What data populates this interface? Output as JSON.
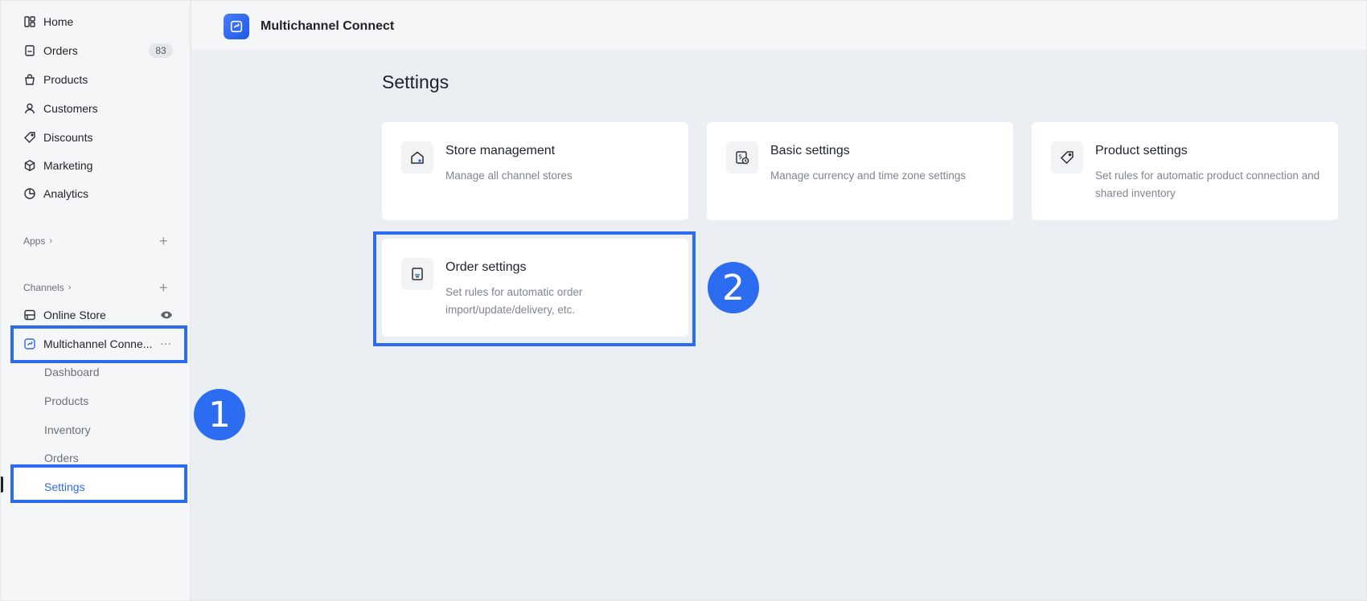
{
  "app": {
    "title": "Multichannel Connect",
    "logo_icon": "app-logo-icon",
    "accent": "#2b6cf0"
  },
  "sidebar": {
    "main_items": [
      {
        "label": "Home",
        "icon": "home-icon"
      },
      {
        "label": "Orders",
        "icon": "orders-icon",
        "badge": "83"
      },
      {
        "label": "Products",
        "icon": "bag-icon"
      },
      {
        "label": "Customers",
        "icon": "person-icon"
      },
      {
        "label": "Discounts",
        "icon": "tag-icon"
      },
      {
        "label": "Marketing",
        "icon": "cube-icon"
      },
      {
        "label": "Analytics",
        "icon": "pie-icon"
      }
    ],
    "apps_label": "Apps",
    "channels_label": "Channels",
    "channels": [
      {
        "label": "Online Store",
        "icon": "store-icon",
        "trailing": "eye-icon"
      },
      {
        "label": "Multichannel Conne...",
        "icon": "multichannel-icon",
        "trailing": "more-icon",
        "more": "···"
      }
    ],
    "sub_items": [
      {
        "label": "Dashboard"
      },
      {
        "label": "Products"
      },
      {
        "label": "Inventory"
      },
      {
        "label": "Orders"
      },
      {
        "label": "Settings",
        "active": true
      }
    ]
  },
  "page": {
    "title": "Settings",
    "cards": [
      {
        "title": "Store management",
        "desc": "Manage all channel stores",
        "icon": "store-management-icon"
      },
      {
        "title": "Basic settings",
        "desc": "Manage currency and time zone settings",
        "icon": "currency-clock-icon"
      },
      {
        "title": "Product settings",
        "desc": "Set rules for automatic product connection and shared inventory",
        "icon": "tag-icon"
      },
      {
        "title": "Order settings",
        "desc": "Set rules for automatic order import/update/delivery, etc.",
        "icon": "order-document-icon"
      }
    ]
  },
  "annotations": {
    "step1": "1",
    "step2": "2"
  }
}
